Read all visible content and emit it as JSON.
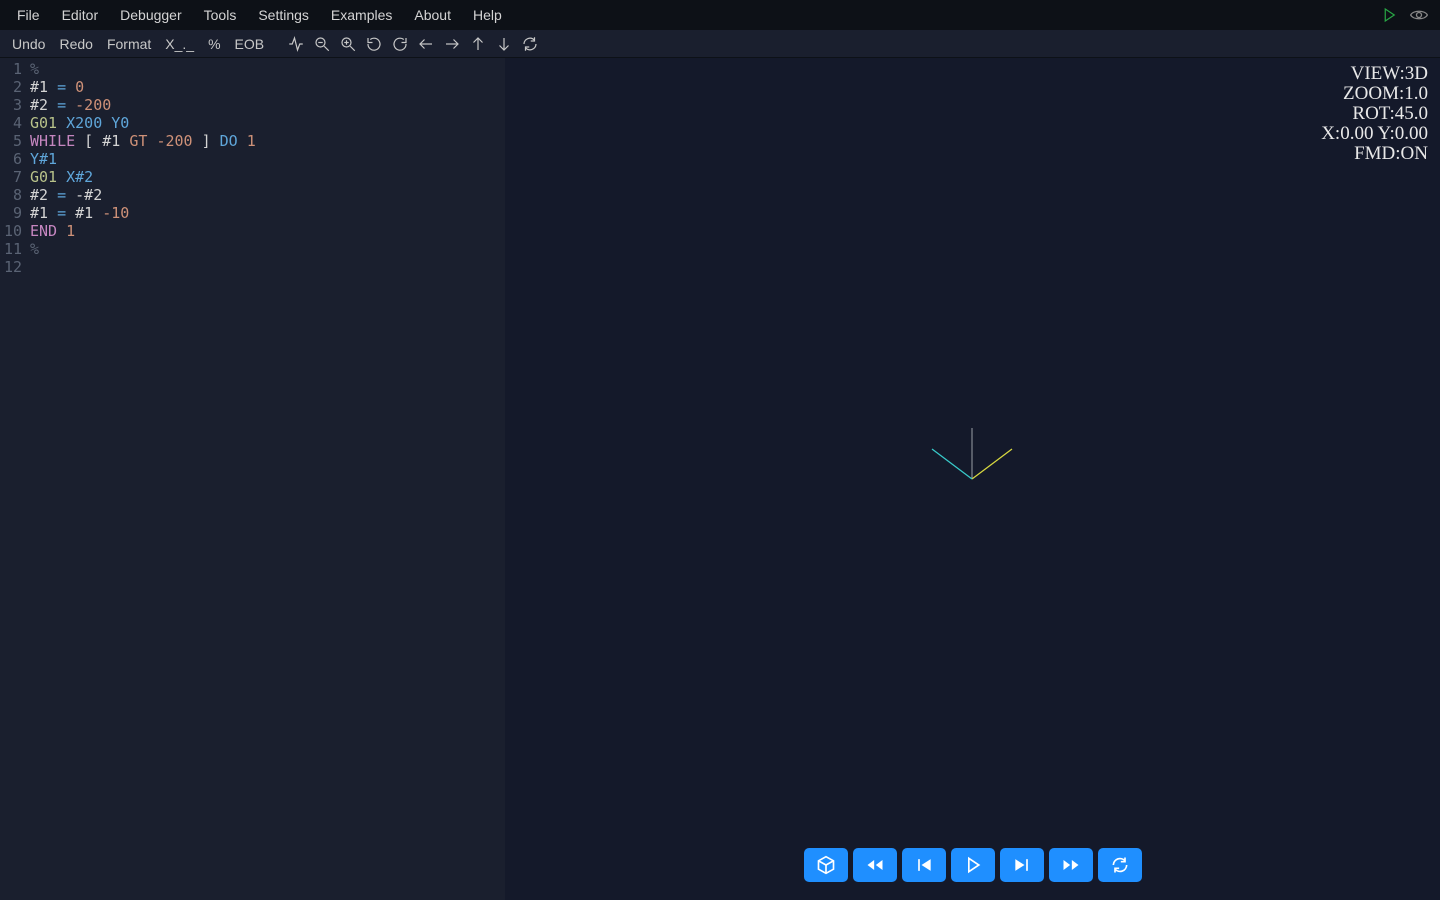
{
  "menubar": {
    "items": [
      "File",
      "Editor",
      "Debugger",
      "Tools",
      "Settings",
      "Examples",
      "About",
      "Help"
    ]
  },
  "toolbar": {
    "undo": "Undo",
    "redo": "Redo",
    "format": "Format",
    "xdot": "X_._",
    "percent": "%",
    "eob": "EOB"
  },
  "overlay": {
    "view": "VIEW:3D",
    "zoom": "ZOOM:1.0",
    "rot": "ROT:45.0",
    "xy": "X:0.00 Y:0.00",
    "fmd": "FMD:ON"
  },
  "code": {
    "lines": [
      [
        {
          "t": "%",
          "c": "comment"
        }
      ],
      [
        {
          "t": "#1",
          "c": "var"
        },
        {
          "t": " ",
          "c": ""
        },
        {
          "t": "=",
          "c": "op"
        },
        {
          "t": " ",
          "c": ""
        },
        {
          "t": "0",
          "c": "num"
        }
      ],
      [
        {
          "t": "#2",
          "c": "var"
        },
        {
          "t": " ",
          "c": ""
        },
        {
          "t": "=",
          "c": "op"
        },
        {
          "t": " ",
          "c": ""
        },
        {
          "t": "-200",
          "c": "num"
        }
      ],
      [
        {
          "t": "G01",
          "c": "gcode"
        },
        {
          "t": " ",
          "c": ""
        },
        {
          "t": "X200",
          "c": "xy"
        },
        {
          "t": " ",
          "c": ""
        },
        {
          "t": "Y0",
          "c": "xy"
        }
      ],
      [
        {
          "t": "WHILE",
          "c": "kw"
        },
        {
          "t": " [ ",
          "c": "var"
        },
        {
          "t": "#1",
          "c": "var"
        },
        {
          "t": " ",
          "c": ""
        },
        {
          "t": "GT",
          "c": "cond"
        },
        {
          "t": " ",
          "c": ""
        },
        {
          "t": "-200",
          "c": "num"
        },
        {
          "t": " ] ",
          "c": "var"
        },
        {
          "t": "DO",
          "c": "do"
        },
        {
          "t": " ",
          "c": ""
        },
        {
          "t": "1",
          "c": "num"
        }
      ],
      [
        {
          "t": "Y#1",
          "c": "xy"
        }
      ],
      [
        {
          "t": "G01",
          "c": "gcode"
        },
        {
          "t": " ",
          "c": ""
        },
        {
          "t": "X#2",
          "c": "xy"
        }
      ],
      [
        {
          "t": "#2",
          "c": "var"
        },
        {
          "t": " ",
          "c": ""
        },
        {
          "t": "=",
          "c": "op"
        },
        {
          "t": " ",
          "c": ""
        },
        {
          "t": "-#2",
          "c": "var"
        }
      ],
      [
        {
          "t": "#1",
          "c": "var"
        },
        {
          "t": " ",
          "c": ""
        },
        {
          "t": "=",
          "c": "op"
        },
        {
          "t": " ",
          "c": ""
        },
        {
          "t": "#1",
          "c": "var"
        },
        {
          "t": " ",
          "c": ""
        },
        {
          "t": "-10",
          "c": "num"
        }
      ],
      [
        {
          "t": "END",
          "c": "kw"
        },
        {
          "t": " ",
          "c": ""
        },
        {
          "t": "1",
          "c": "num"
        }
      ],
      [
        {
          "t": "%",
          "c": "comment"
        }
      ],
      []
    ]
  }
}
